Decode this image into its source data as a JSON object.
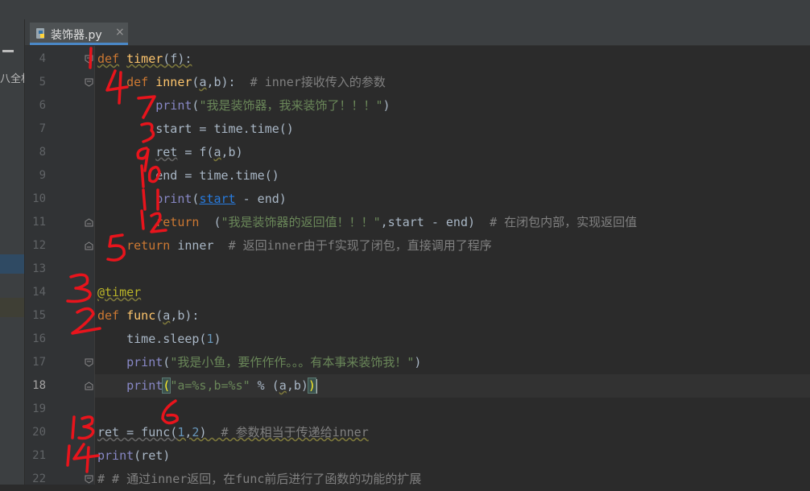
{
  "tab": {
    "label": "装饰器.py",
    "close": "×",
    "icon": "python-file-icon"
  },
  "left_panel": {
    "text": "八全材"
  },
  "current_line": 18,
  "lines": [
    {
      "num": "4"
    },
    {
      "num": "5"
    },
    {
      "num": "6"
    },
    {
      "num": "7"
    },
    {
      "num": "8"
    },
    {
      "num": "9"
    },
    {
      "num": "10"
    },
    {
      "num": "11"
    },
    {
      "num": "12"
    },
    {
      "num": "13"
    },
    {
      "num": "14"
    },
    {
      "num": "15"
    },
    {
      "num": "16"
    },
    {
      "num": "17"
    },
    {
      "num": "18"
    },
    {
      "num": "19"
    },
    {
      "num": "20"
    },
    {
      "num": "21"
    },
    {
      "num": "22"
    }
  ],
  "code": {
    "l4": {
      "kw": "def",
      "name": "timer",
      "rest": "(f):"
    },
    "l5": {
      "kw": "def",
      "name": "inner",
      "p1": "(",
      "a": "a",
      "p2": ",b):  ",
      "comment": "# inner接收传入的参数"
    },
    "l6": {
      "fn": "print",
      "p1": "(",
      "str": "\"我是装饰器，我来装饰了！！！\"",
      "p2": ")"
    },
    "l7": {
      "text": "start = time.time()"
    },
    "l8": {
      "var": "ret",
      "rest1": " = f(",
      "a": "a",
      "rest2": ",b)"
    },
    "l9": {
      "text": "end = time.time()"
    },
    "l10": {
      "fn": "print",
      "p1": "(",
      "var": "start",
      "rest": " - end)"
    },
    "l11": {
      "kw": "return",
      "rest1": "  (",
      "str": "\"我是装饰器的返回值！！！\"",
      "rest2": ",start - end)  ",
      "comment": "# 在闭包内部，实现返回值"
    },
    "l12": {
      "kw": "return",
      "rest": " inner  ",
      "comment": "# 返回inner由于f实现了闭包，直接调用了程序"
    },
    "l14": {
      "dec": "@timer"
    },
    "l15": {
      "kw": "def",
      "name": "func",
      "p1": "(",
      "a": "a",
      "p2": ",b):"
    },
    "l16": {
      "text": "time.sleep(",
      "num": "1",
      "end": ")"
    },
    "l17": {
      "fn": "print",
      "p1": "(",
      "str": "\"我是小鱼，要作作作。。。有本事来装饰我！\"",
      "p2": ")"
    },
    "l18": {
      "fn": "print",
      "p0": "(",
      "str": "\"a=%s,b=%s\"",
      "mid": " % (",
      "a": "a",
      "rest": ",b)",
      "p9": ")"
    },
    "l20": {
      "text": "ret = func(",
      "n1": "1",
      "sep": ",",
      "n2": "2",
      "end": ")  ",
      "comment": "# 参数相当于传递给inner"
    },
    "l21": {
      "fn": "print",
      "rest": "(ret)"
    },
    "l22": {
      "comment": "# # 通过inner返回，在func前后进行了函数的功能的扩展"
    }
  },
  "annotations": [
    "1",
    "4",
    "7",
    "3",
    "9",
    "10",
    "11",
    "12",
    "5",
    "3",
    "2",
    "6",
    "13",
    "14"
  ],
  "colors": {
    "background": "#2b2b2b",
    "keyword": "#cc7832",
    "string": "#6a8759",
    "comment": "#808080",
    "ink": "#e8141c"
  }
}
